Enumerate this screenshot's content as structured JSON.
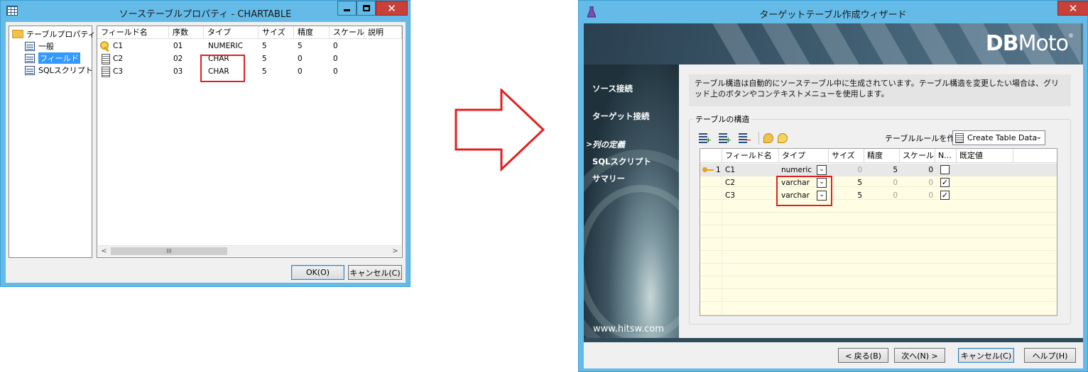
{
  "source_window": {
    "title": "ソーステーブルプロパティ - CHARTABLE",
    "close_glyph": "✕",
    "tree": {
      "root": "テーブルプロパティ",
      "items": [
        "一般",
        "フィールド",
        "SQLスクリプト"
      ],
      "selected": "フィールド"
    },
    "grid": {
      "columns": [
        "フィールド名",
        "序数",
        "タイプ",
        "サイズ",
        "精度",
        "スケール",
        "説明"
      ],
      "rows": [
        {
          "name": "C1",
          "ordinal": "01",
          "type": "NUMERIC",
          "size": "5",
          "precision": "5",
          "scale": "0",
          "desc": "",
          "icon": "key-icon"
        },
        {
          "name": "C2",
          "ordinal": "02",
          "type": "CHAR",
          "size": "5",
          "precision": "0",
          "scale": "0",
          "desc": "",
          "icon": "column-icon"
        },
        {
          "name": "C3",
          "ordinal": "03",
          "type": "CHAR",
          "size": "5",
          "precision": "0",
          "scale": "0",
          "desc": "",
          "icon": "column-icon"
        }
      ],
      "scroll_left": "<",
      "scroll_right": ">",
      "scroll_thumb": "III"
    },
    "buttons": {
      "ok": "OK(O)",
      "cancel": "キャンセル(C)"
    }
  },
  "target_window": {
    "title": "ターゲットテーブル作成ウィザード",
    "close_glyph": "✕",
    "logo": {
      "bold": "DB",
      "light": "Moto",
      "reg": "®"
    },
    "steps": [
      "ソース接続",
      "ターゲット接続",
      "列の定義",
      "SQLスクリプト",
      "サマリー"
    ],
    "active_step": "列の定義",
    "active_marker": ">",
    "url": "www.hitsw.com",
    "description": "テーブル構造は自動的にソーステーブル中に生成されています。テーブル構造を変更したい場合は、グリッド上のボタンやコンテキストメニューを使用します。",
    "group_title": "テーブルの構造",
    "rule_label": "テーブルルールを作",
    "rule_select": "Create Table Data",
    "grid": {
      "columns": [
        "フィールド名",
        "タイプ",
        "サイズ",
        "精度",
        "スケール",
        "N...",
        "既定値"
      ],
      "rows": [
        {
          "index": "1",
          "name": "C1",
          "type": "numeric",
          "size": "0",
          "precision": "5",
          "scale": "0",
          "nullable": false,
          "default": ""
        },
        {
          "index": "",
          "name": "C2",
          "type": "varchar",
          "size": "5",
          "precision": "0",
          "scale": "0",
          "nullable": true,
          "default": ""
        },
        {
          "index": "",
          "name": "C3",
          "type": "varchar",
          "size": "5",
          "precision": "0",
          "scale": "0",
          "nullable": true,
          "default": ""
        }
      ]
    },
    "buttons": {
      "back": "< 戻る(B)",
      "next": "次へ(N) >",
      "cancel": "キャンセル(C)",
      "help": "ヘルプ(H)"
    }
  },
  "colors": {
    "highlight_box": "#e02020",
    "titlebar": "#65bbe8",
    "close_button": "#c7413a",
    "selection": "#3399ff"
  }
}
